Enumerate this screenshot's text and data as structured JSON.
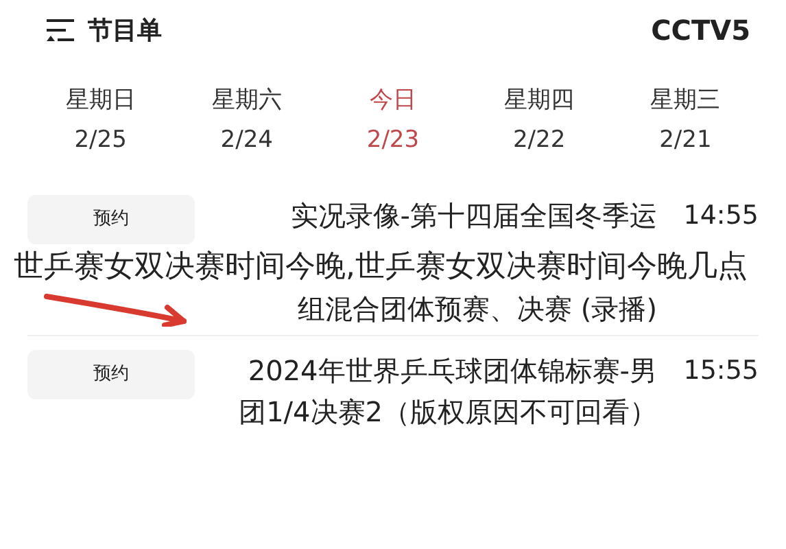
{
  "header": {
    "title": "节目单",
    "channel": "CCTV5"
  },
  "days": [
    {
      "label": "星期日",
      "date": "2/25",
      "selected": false
    },
    {
      "label": "星期六",
      "date": "2/24",
      "selected": false
    },
    {
      "label": "今日",
      "date": "2/23",
      "selected": true
    },
    {
      "label": "星期四",
      "date": "2/22",
      "selected": false
    },
    {
      "label": "星期三",
      "date": "2/21",
      "selected": false
    }
  ],
  "programs": [
    {
      "time": "14:55",
      "title_lines": [
        "实况录像-第十四届全国冬季运",
        "组混合团体预赛、决赛 (录播)"
      ],
      "button": "预约"
    },
    {
      "time": "15:55",
      "title_lines": [
        "2024年世界乒乓球团体锦标赛-男团1/4决赛2（版权原因不可回看）"
      ],
      "button": "预约"
    }
  ],
  "caption": "世乒赛女双决赛时间今晚,世乒赛女双决赛时间今晚几点"
}
